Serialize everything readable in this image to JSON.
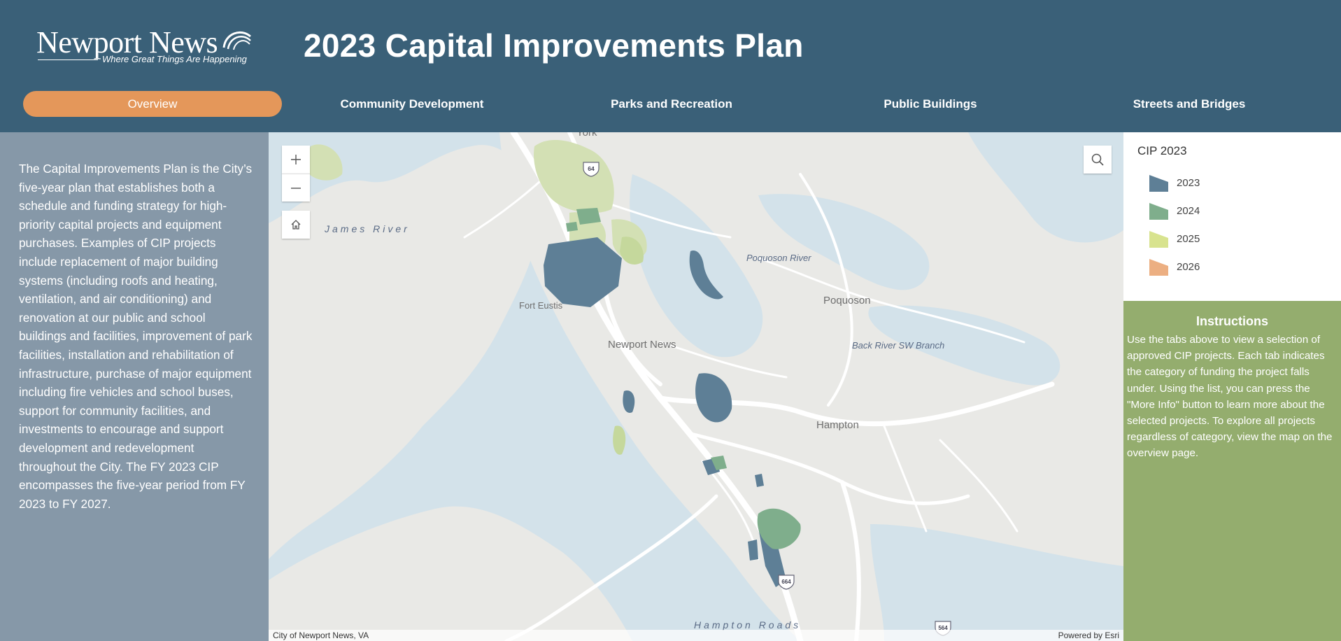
{
  "header": {
    "logo_main": "Newport News",
    "logo_tagline": "Where Great Things Are Happening",
    "title": "2023 Capital Improvements Plan"
  },
  "tabs": [
    {
      "label": "Overview",
      "active": true
    },
    {
      "label": "Community Development",
      "active": false
    },
    {
      "label": "Parks and Recreation",
      "active": false
    },
    {
      "label": "Public Buildings",
      "active": false
    },
    {
      "label": "Streets and Bridges",
      "active": false
    }
  ],
  "intro": {
    "text": "The Capital Improvements Plan is the City’s five-year plan that establishes both a schedule and funding strategy for high-priority capital projects and equipment purchases. Examples of CIP projects include replacement of major building systems (including roofs and heating, ventilation, and air conditioning) and renovation at our public and school buildings and facilities, improvement of park facilities, installation and rehabilitation of infrastructure, purchase of major equipment including fire vehicles and school buses, support for community facilities, and investments to encourage and support development and redevelopment throughout the City. The FY 2023 CIP encompasses the five-year period from FY 2023 to FY 2027."
  },
  "map": {
    "labels": {
      "york": "York",
      "james_river": "James River",
      "poquoson_river": "Poquoson River",
      "poquoson": "Poquoson",
      "fort_eustis": "Fort Eustis",
      "newport_news": "Newport News",
      "back_river": "Back River SW Branch",
      "hampton": "Hampton",
      "hampton_roads": "Hampton Roads"
    },
    "shields": {
      "i64": "64",
      "i664": "664",
      "i564": "564"
    },
    "attribution_left": "City of Newport News, VA",
    "attribution_right": "Powered by Esri",
    "icons": {
      "zoom_in": "plus-icon",
      "zoom_out": "minus-icon",
      "home": "home-icon",
      "search": "search-icon"
    }
  },
  "legend": {
    "title": "CIP 2023",
    "items": [
      {
        "label": "2023",
        "color": "#5e7f96"
      },
      {
        "label": "2024",
        "color": "#7fae8c"
      },
      {
        "label": "2025",
        "color": "#d8e38f"
      },
      {
        "label": "2026",
        "color": "#ecaf82"
      }
    ]
  },
  "instructions": {
    "title": "Instructions",
    "text": "Use the tabs above to view a selection of approved CIP projects. Each tab indicates the category of funding the project falls under. Using the list, you can press the \"More Info\" button to learn more about the selected projects. To explore all projects regardless of category, view the map on the overview page."
  },
  "colors": {
    "header_bg": "#3a6078",
    "active_tab": "#e4975a",
    "left_panel": "#8698a8",
    "instructions_bg": "#94ad6e",
    "water": "#d3e2ea",
    "land": "#e9e9e6"
  }
}
